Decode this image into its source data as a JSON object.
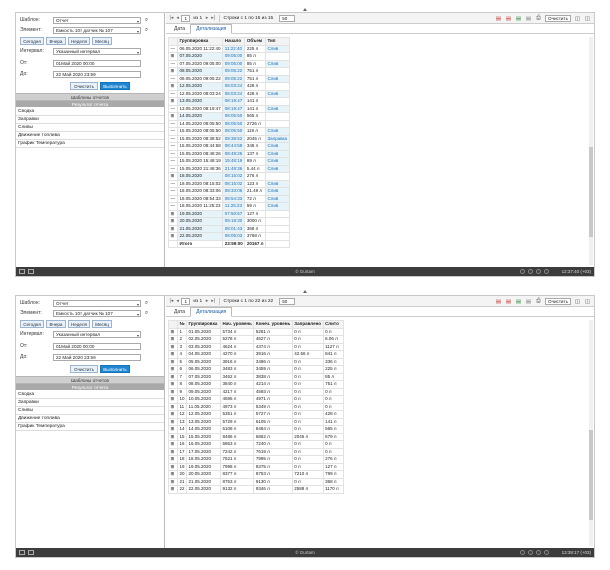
{
  "panels": [
    {
      "filter": {
        "template_label": "Шаблон:",
        "template_value": "Отчет",
        "element_label": "Элемент:",
        "element_value": "Емкость 10т датчик № 107",
        "period_buttons": [
          "Сегодня",
          "Вчера",
          "Неделя",
          "Месяц"
        ],
        "interval_label": "Интервал:",
        "interval_value": "Указанный интервал",
        "from_label": "От:",
        "from_value": "01Май 2020 00:00",
        "to_label": "До:",
        "to_value": "22 Май 2020 23:59",
        "clear_label": "Очистить",
        "execute_label": "Выполнить",
        "templates_header": "Шаблоны отчетов",
        "results_header": "Результат отчета",
        "reports": [
          "Сводка",
          "Заправки",
          "Сливы",
          "Движение топлива",
          "График Температура"
        ]
      },
      "toolbar": {
        "page": "1",
        "of": "из 1",
        "rows_text": "Строки с 1 по 15 из 15",
        "page_size": "50",
        "clear": "Очистить"
      },
      "tabs": [
        "Дата",
        "Детализация"
      ],
      "table": {
        "columns": [
          "",
          "Группировка",
          "Начало",
          "Объем",
          "Тип"
        ],
        "rows": [
          [
            "—",
            "06.05.2020 11:22:40",
            "11:22:40",
            "225 л",
            "Слив"
          ],
          [
            "⊞",
            "07.05.2020",
            "09:05:00",
            "85 л",
            ""
          ],
          [
            "—",
            "07.05.2020 09:05:00",
            "09:05:00",
            "85 л",
            "Слив"
          ],
          [
            "⊞",
            "08.05.2020",
            "09:05:22",
            "751 л",
            ""
          ],
          [
            "—",
            "08.05.2020 09:05:22",
            "09:05:22",
            "751 л",
            "Слив"
          ],
          [
            "⊞",
            "12.05.2020",
            "08:03:24",
            "428 л",
            ""
          ],
          [
            "—",
            "12.05.2020 08:03:24",
            "08:03:24",
            "428 л",
            "Слив"
          ],
          [
            "⊞",
            "13.05.2020",
            "08:19:47",
            "141 л",
            ""
          ],
          [
            "—",
            "13.05.2020 08:19:47",
            "08:19:47",
            "141 л",
            "Слив"
          ],
          [
            "⊞",
            "14.05.2020",
            "08:05:50",
            "565 л",
            ""
          ],
          [
            "—",
            "14.05.2020 08:05:50",
            "08:05:50",
            "2726 л",
            ""
          ],
          [
            "—",
            "15.05.2020 08:05:50",
            "08:05:50",
            "119 л",
            "Слив"
          ],
          [
            "—",
            "15.05.2020 08:38:52",
            "08:38:52",
            "2045 л",
            "Заправка"
          ],
          [
            "—",
            "15.05.2020 08:44:58",
            "08:44:58",
            "348 л",
            "Слив"
          ],
          [
            "—",
            "15.05.2020 08:48:26",
            "08:48:26",
            "137 л",
            "Слив"
          ],
          [
            "—",
            "15.05.2020 15:48:19",
            "15:48:19",
            "69 л",
            "Слив"
          ],
          [
            "—",
            "15.05.2020 21:48:36",
            "21:48:36",
            "5.44 л",
            "Слив"
          ],
          [
            "⊞",
            "18.05.2020",
            "08:15:02",
            "276 л",
            ""
          ],
          [
            "—",
            "18.05.2020 08:15:02",
            "08:15:02",
            "123 л",
            "Слив"
          ],
          [
            "—",
            "18.05.2020 08:33:06",
            "08:33:06",
            "21.49 л",
            "Слив"
          ],
          [
            "—",
            "18.05.2020 08:54:33",
            "08:54:33",
            "72 л",
            "Слив"
          ],
          [
            "—",
            "18.05.2020 11:25:23",
            "11:25:23",
            "59 л",
            "Слив"
          ],
          [
            "⊞",
            "19.05.2020",
            "07:50:57",
            "127 л",
            ""
          ],
          [
            "⊞",
            "20.05.2020",
            "09:19:30",
            "3000 л",
            ""
          ],
          [
            "⊞",
            "21.05.2020",
            "08:01:43",
            "368 л",
            ""
          ],
          [
            "⊞",
            "22.05.2020",
            "08:05:03",
            "3768 л",
            ""
          ]
        ],
        "total": [
          "",
          "Итого",
          "23:59:00",
          "20167 л",
          ""
        ]
      },
      "status": {
        "brand": "© Gurtam",
        "time": "12:37:40 (+03)"
      }
    },
    {
      "filter": {
        "template_label": "Шаблон:",
        "template_value": "Отчет",
        "element_label": "Элемент:",
        "element_value": "Емкость 10т датчик № 107",
        "period_buttons": [
          "Сегодня",
          "Вчера",
          "Неделя",
          "Месяц"
        ],
        "interval_label": "Интервал:",
        "interval_value": "Указанный интервал",
        "from_label": "От:",
        "from_value": "01Май 2020 00:00",
        "to_label": "До:",
        "to_value": "22 Май 2020 23:59",
        "clear_label": "Очистить",
        "execute_label": "Выполнить",
        "templates_header": "Шаблоны отчетов",
        "results_header": "Результат отчета",
        "reports": [
          "Сводка",
          "Заправки",
          "Сливы",
          "Движение топлива",
          "График Температура"
        ]
      },
      "toolbar": {
        "page": "1",
        "of": "из 1",
        "rows_text": "Строки с 1 по 22 из 22",
        "page_size": "50",
        "clear": "Очистить"
      },
      "tabs": [
        "Дата",
        "Детализация"
      ],
      "table": {
        "columns": [
          "",
          "№",
          "Группировка",
          "Нач. уровень",
          "Конеч. уровень",
          "Заправлено",
          "Слито"
        ],
        "rows": [
          [
            "⊞",
            "1",
            "01.05.2020",
            "5734 л",
            "5281 л",
            "0 л",
            "0 л"
          ],
          [
            "⊞",
            "2",
            "02.05.2020",
            "5278 л",
            "4627 л",
            "0 л",
            "6.06 л"
          ],
          [
            "⊞",
            "3",
            "03.05.2020",
            "4624 л",
            "4374 л",
            "0 л",
            "1127 л"
          ],
          [
            "⊞",
            "4",
            "04.05.2020",
            "4270 л",
            "3916 л",
            "42.56 л",
            "841 л"
          ],
          [
            "⊞",
            "5",
            "05.05.2020",
            "3916 л",
            "3486 л",
            "0 л",
            "336 л"
          ],
          [
            "⊞",
            "6",
            "06.05.2020",
            "3483 л",
            "3459 л",
            "0 л",
            "225 л"
          ],
          [
            "⊞",
            "7",
            "07.05.2020",
            "3462 л",
            "3838 л",
            "0 л",
            "85 л"
          ],
          [
            "⊞",
            "8",
            "08.05.2020",
            "3840 л",
            "4214 л",
            "0 л",
            "751 л"
          ],
          [
            "⊞",
            "9",
            "09.05.2020",
            "4217 л",
            "4593 л",
            "0 л",
            "0 л"
          ],
          [
            "⊞",
            "10",
            "10.05.2020",
            "4595 л",
            "4971 л",
            "0 л",
            "0 л"
          ],
          [
            "⊞",
            "11",
            "11.05.2020",
            "4973 л",
            "5349 л",
            "0 л",
            "0 л"
          ],
          [
            "⊞",
            "12",
            "12.05.2020",
            "5351 л",
            "5727 л",
            "0 л",
            "428 л"
          ],
          [
            "⊞",
            "13",
            "13.05.2020",
            "5729 л",
            "6105 л",
            "0 л",
            "141 л"
          ],
          [
            "⊞",
            "14",
            "14.05.2020",
            "6108 л",
            "8484 л",
            "0 л",
            "565 л"
          ],
          [
            "⊞",
            "15",
            "15.05.2020",
            "8486 л",
            "6862 л",
            "2045 л",
            "679 л"
          ],
          [
            "⊞",
            "16",
            "16.05.2020",
            "6863 л",
            "7240 л",
            "0 л",
            "0 л"
          ],
          [
            "⊞",
            "17",
            "17.05.2020",
            "7242 л",
            "7619 л",
            "0 л",
            "0 л"
          ],
          [
            "⊞",
            "18",
            "18.05.2020",
            "7621 л",
            "7995 л",
            "0 л",
            "276 л"
          ],
          [
            "⊞",
            "19",
            "19.05.2020",
            "7998 л",
            "8375 л",
            "0 л",
            "127 л"
          ],
          [
            "⊞",
            "20",
            "20.05.2020",
            "8377 л",
            "8753 л",
            "7210 л",
            "799 л"
          ],
          [
            "⊞",
            "21",
            "21.05.2020",
            "8753 л",
            "9130 л",
            "0 л",
            "368 л"
          ],
          [
            "⊞",
            "22",
            "22.05.2020",
            "9132 л",
            "9346 л",
            "2588 л",
            "1170 л"
          ]
        ]
      },
      "status": {
        "brand": "© Gurtam",
        "time": "13:39:17 (+03)"
      }
    }
  ],
  "colors": {
    "primary_button": "#1f86d4",
    "highlight": "#e6f3f8",
    "link": "#1d6fb8",
    "status_bar": "#3c3c3c"
  }
}
